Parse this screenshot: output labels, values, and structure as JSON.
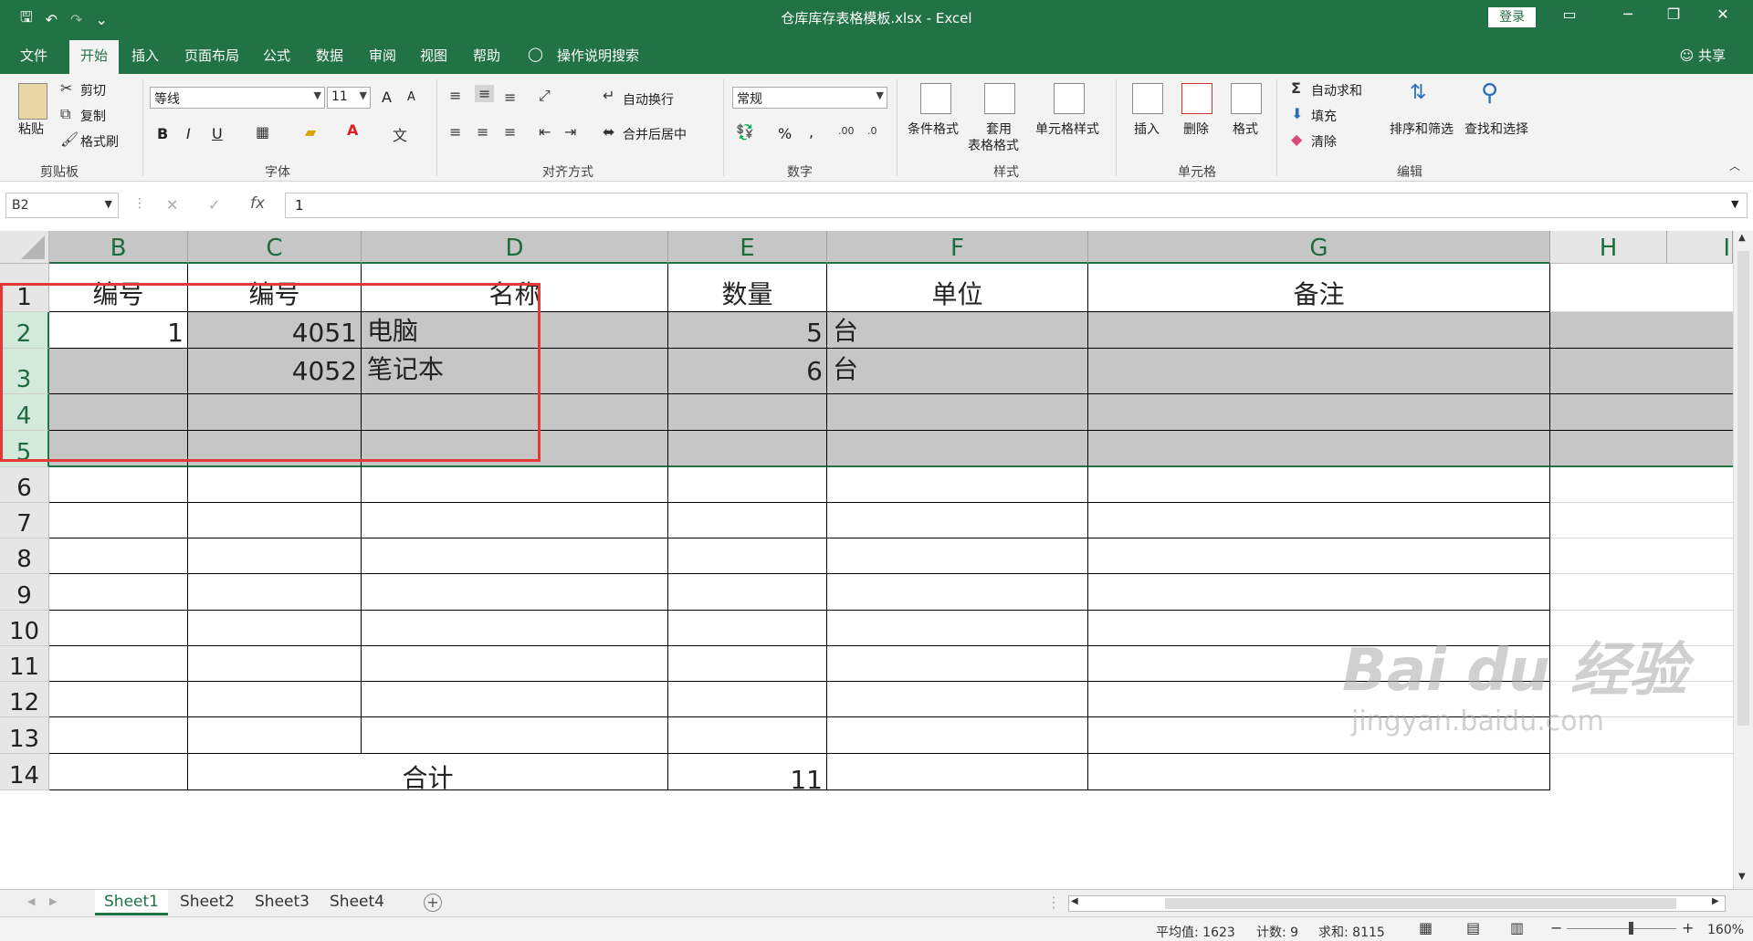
{
  "titlebar": {
    "title": "仓库库存表格模板.xlsx  -  Excel",
    "login": "登录",
    "qat_save": "🖫",
    "qat_undo": "↶",
    "qat_redo": "↷",
    "qat_more": "⌄",
    "ribbon_display_icon": "▭",
    "minimize_icon": "─",
    "restore_icon": "❐",
    "close_icon": "✕"
  },
  "tabs": {
    "items": [
      "文件",
      "开始",
      "插入",
      "页面布局",
      "公式",
      "数据",
      "审阅",
      "视图",
      "帮助"
    ],
    "tell_me": "操作说明搜索",
    "share": "共享"
  },
  "ribbon": {
    "clipboard": {
      "paste": "粘贴",
      "cut": "剪切",
      "copy": "复制",
      "format_painter": "格式刷",
      "label": "剪贴板"
    },
    "font": {
      "name": "等线",
      "size": "11",
      "label": "字体",
      "bold": "B",
      "italic": "I",
      "underline": "U",
      "grow": "A",
      "shrink": "A"
    },
    "alignment": {
      "wrap": "自动换行",
      "merge": "合并后居中",
      "label": "对齐方式"
    },
    "number": {
      "format": "常规",
      "percent": "%",
      "comma": ",",
      "label": "数字"
    },
    "styles": {
      "conditional": "条件格式",
      "table_1": "套用",
      "table_2": "表格格式",
      "cell_styles": "单元格样式",
      "label": "样式"
    },
    "cells": {
      "insert": "插入",
      "delete": "删除",
      "format": "格式",
      "label": "单元格"
    },
    "editing": {
      "autosum": "自动求和",
      "fill": "填充",
      "clear": "清除",
      "sort": "排序和筛选",
      "find": "查找和选择",
      "label": "编辑"
    }
  },
  "formula_bar": {
    "name_box": "B2",
    "cancel_icon": "✕",
    "enter_icon": "✓",
    "fx": "fx",
    "value": "1"
  },
  "columns": [
    "B",
    "C",
    "D",
    "E",
    "F",
    "G",
    "H",
    "I"
  ],
  "rows": [
    "1",
    "2",
    "3",
    "4",
    "5",
    "6",
    "7",
    "8",
    "9",
    "10",
    "11",
    "12",
    "13",
    "14"
  ],
  "cells": {
    "header": [
      "编号",
      "编号",
      "名称",
      "数量",
      "单位",
      "备注"
    ],
    "r2": {
      "b": "1",
      "c": "4051",
      "d": "电脑",
      "e": "5",
      "f": "台"
    },
    "r3": {
      "c": "4052",
      "d": "笔记本",
      "e": "6",
      "f": "台"
    },
    "r14": {
      "label": "合计",
      "e": "11"
    }
  },
  "sheets": [
    "Sheet1",
    "Sheet2",
    "Sheet3",
    "Sheet4"
  ],
  "status": {
    "average": "平均值: 1623",
    "count": "计数: 9",
    "sum": "求和: 8115",
    "zoom": "160%"
  },
  "watermark": {
    "text": "Bai du 经验",
    "url": "jingyan.baidu.com"
  }
}
